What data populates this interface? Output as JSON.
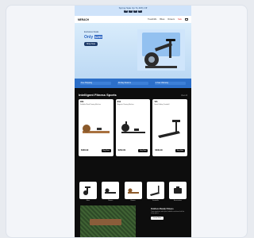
{
  "promo": {
    "text": "Spring Sale Up To 40% Off",
    "countdown": [
      "02",
      "14",
      "36",
      "09"
    ]
  },
  "nav": {
    "logo": "MERACH",
    "links": [
      "Treadmills",
      "Bikes",
      "Rowers",
      "Sale"
    ]
  },
  "hero": {
    "subtitle": "Exclusive Deals",
    "price_prefix": "Only ",
    "price_value": "$299",
    "cta": "Shop Now"
  },
  "strip": [
    "Free Shipping",
    "30-Day Returns",
    "2-Year Warranty"
  ],
  "section": {
    "title": "Intelligent Fitness Sports",
    "see_all": "View All"
  },
  "products": [
    {
      "name": "R50",
      "desc": "Foldable Wood Rowing Machine",
      "price": "$399.99",
      "buy": "Buy Now"
    },
    {
      "name": "R12",
      "desc": "Magnetic Rowing Machine",
      "price": "$299.99",
      "buy": "Buy Now"
    },
    {
      "name": "T25",
      "desc": "Smart Folding Treadmill",
      "price": "$499.99",
      "buy": "Buy Now"
    }
  ],
  "categories": [
    "Bikes",
    "Rowers",
    "Rowers",
    "Treadmills",
    "Accessories"
  ],
  "info": {
    "heading": "Outdoor-Ready Fitness",
    "text": "Train anywhere with quiet, foldable machines built for every space.",
    "button": "Learn More"
  }
}
